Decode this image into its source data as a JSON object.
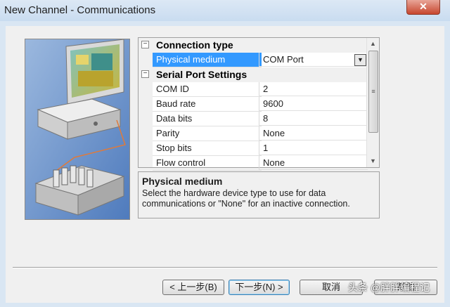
{
  "window": {
    "title": "New Channel - Communications",
    "close_glyph": "✕"
  },
  "property_grid": {
    "categories": [
      {
        "label": "Connection type",
        "expander": "−"
      },
      {
        "label": "Serial Port Settings",
        "expander": "−"
      }
    ],
    "properties": [
      {
        "name": "Physical medium",
        "value": "COM Port",
        "selected": true
      },
      {
        "name": "COM ID",
        "value": "2"
      },
      {
        "name": "Baud rate",
        "value": "9600"
      },
      {
        "name": "Data bits",
        "value": "8"
      },
      {
        "name": "Parity",
        "value": "None"
      },
      {
        "name": "Stop bits",
        "value": "1"
      },
      {
        "name": "Flow control",
        "value": "None"
      }
    ],
    "dropdown_glyph": "▼",
    "scroll_up": "▲",
    "scroll_down": "▼",
    "thumb_grip": "≡"
  },
  "description": {
    "title": "Physical medium",
    "text": "Select the hardware device type to use for data communications or \"None\" for an inactive connection."
  },
  "buttons": {
    "back": "< 上一步(B)",
    "next": "下一步(N) >",
    "cancel": "取消",
    "help": "帮助"
  },
  "watermark": "头条 @胖胖编程记",
  "colors": {
    "selection": "#3399ff",
    "illustration_bg": "#6b93c9"
  }
}
